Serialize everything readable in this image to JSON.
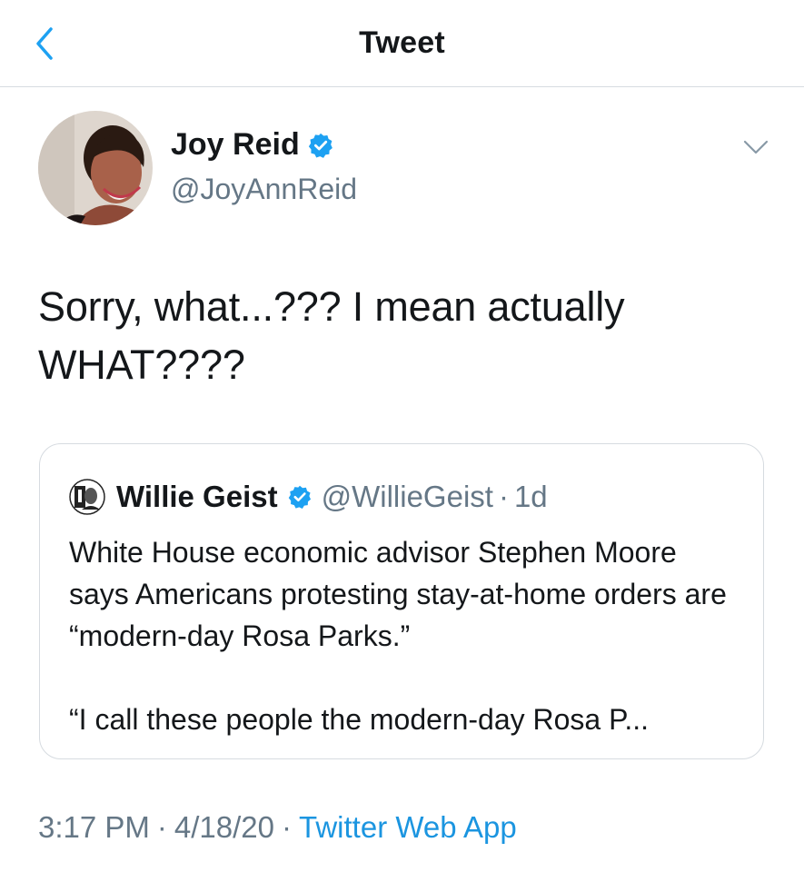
{
  "header": {
    "title": "Tweet",
    "back_icon": "chevron-left-icon"
  },
  "tweet": {
    "author": {
      "name": "Joy Reid",
      "handle": "@JoyAnnReid",
      "verified": true
    },
    "text_lines": [
      "Sorry, what...??? I mean actually",
      "WHAT????"
    ],
    "menu_icon": "chevron-down-icon",
    "quote": {
      "author_name": "Willie Geist",
      "author_handle": "@WillieGeist",
      "separator": "·",
      "time": "1d",
      "verified": true,
      "paragraphs": [
        "White House economic advisor Stephen Moore says Americans protesting stay-at-home orders are “modern-day Rosa Parks.”",
        "“I call these people the modern-day Rosa P..."
      ]
    },
    "meta": {
      "time": "3:17 PM",
      "date": "4/18/20",
      "separator": "·",
      "source": "Twitter Web App"
    }
  },
  "colors": {
    "accent": "#1da1f2",
    "link": "#1b95e0",
    "text": "#14171a",
    "secondary": "#657786",
    "border": "#d6dbe0"
  }
}
